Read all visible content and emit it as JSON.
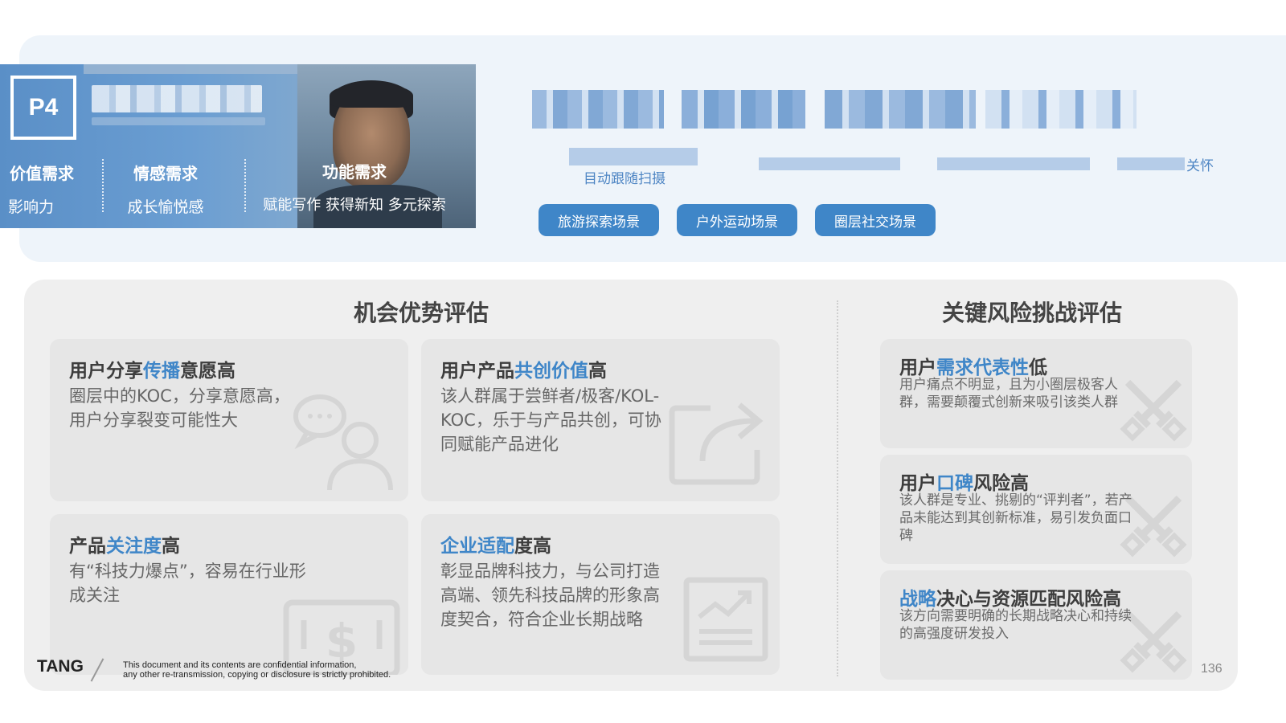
{
  "persona": {
    "badge": "P4",
    "needs": [
      {
        "title": "价值需求",
        "desc": "影响力"
      },
      {
        "title": "情感需求",
        "desc": "成长愉悦感"
      },
      {
        "title": "功能需求",
        "desc": "赋能写作  获得新知  多元探索"
      }
    ]
  },
  "features": {
    "captions": [
      "目动跟随扫摄",
      "",
      "",
      "关怀"
    ]
  },
  "scenes": [
    "旅游探索场景",
    "户外运动场景",
    "圈层社交场景"
  ],
  "opportunity": {
    "title": "机会优势评估",
    "cards": [
      {
        "head_pre": "用户分享",
        "head_hl": "传播",
        "head_post": "意愿高",
        "body": "圈层中的KOC，分享意愿高，用户分享裂变可能性大",
        "icon": "chat-user-icon"
      },
      {
        "head_pre": "用户产品",
        "head_hl": "共创价值",
        "head_post": "高",
        "body": "该人群属于尝鲜者/极客/KOL-KOC，乐于与产品共创，可协同赋能产品进化",
        "icon": "share-icon"
      },
      {
        "head_pre": "产品",
        "head_hl": "关注度",
        "head_post": "高",
        "body": "有“科技力爆点”，容易在行业形成关注",
        "icon": "dollar-icon"
      },
      {
        "head_pre": "",
        "head_hl": "企业适配",
        "head_post": "度高",
        "body": "彰显品牌科技力，与公司打造高端、领先科技品牌的形象高度契合，符合企业长期战略",
        "icon": "chart-icon"
      }
    ]
  },
  "risk": {
    "title": "关键风险挑战评估",
    "cards": [
      {
        "head_pre": "用户",
        "head_hl": "需求代表性",
        "head_post": "低",
        "body": "用户痛点不明显，且为小圈层极客人群，需要颠覆式创新来吸引该类人群"
      },
      {
        "head_pre": "用户",
        "head_hl": "口碑",
        "head_post": "风险高",
        "body": "该人群是专业、挑剔的“评判者”，若产品未能达到其创新标准，易引发负面口碑"
      },
      {
        "head_pre": "",
        "head_hl": "战略",
        "head_post": "决心与资源匹配风险高",
        "body": "该方向需要明确的长期战略决心和持续的高强度研发投入"
      }
    ]
  },
  "footer": {
    "brand": "TANG",
    "note_line1": "This document and its contents are confidential information,",
    "note_line2": "any other re-transmission, copying or disclosure is strictly prohibited.",
    "page": "136"
  },
  "colors": {
    "accent": "#3f86c8",
    "panel": "#efefef",
    "card": "#e6e6e6",
    "band": "#eef4fa"
  }
}
